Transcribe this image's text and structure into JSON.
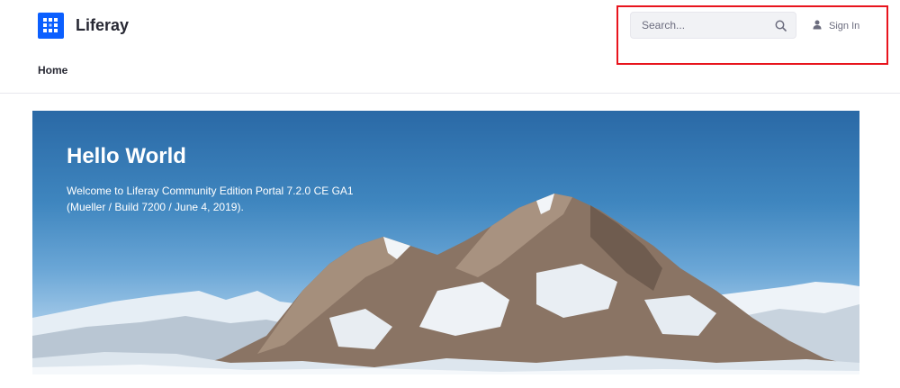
{
  "header": {
    "site_name": "Liferay",
    "logo_icon": "liferay-logo-icon",
    "brand_color": "#0b5fff"
  },
  "nav": {
    "items": [
      {
        "label": "Home"
      }
    ]
  },
  "search": {
    "placeholder": "Search...",
    "icon": "search-icon"
  },
  "user": {
    "sign_in_label": "Sign In",
    "icon": "user-icon"
  },
  "highlight": {
    "color": "#e8141d"
  },
  "banner": {
    "title": "Hello World",
    "text": "Welcome to Liferay Community Edition Portal 7.2.0 CE GA1 (Mueller / Build 7200 / June 4, 2019).",
    "image": "snowy-mountain-landscape"
  }
}
